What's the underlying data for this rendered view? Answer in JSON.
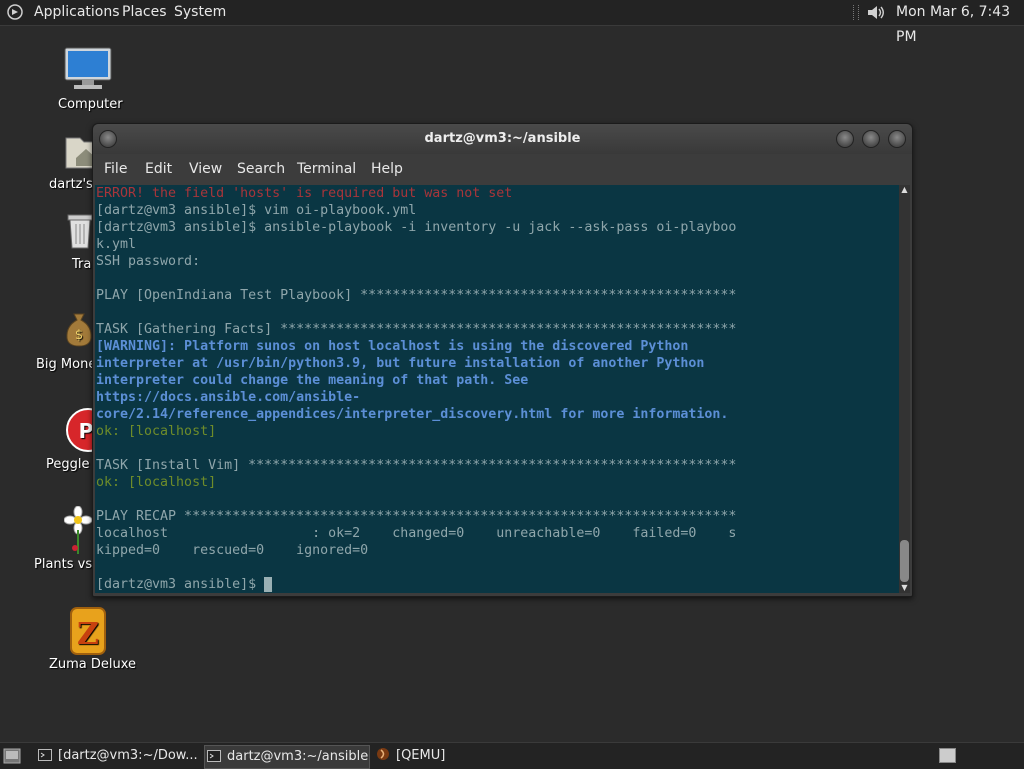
{
  "top_panel": {
    "menus": [
      "Applications",
      "Places",
      "System"
    ],
    "clock": "Mon Mar  6,  7:43 PM",
    "icons": {
      "apps": "gnome-foot-icon",
      "volume": "speaker-icon"
    }
  },
  "desktop_icons": [
    {
      "label": "Computer",
      "icon": "computer-icon"
    },
    {
      "label": "dartz's",
      "icon": "home-folder-icon"
    },
    {
      "label": "Tra",
      "icon": "trash-icon"
    },
    {
      "label": "Big Mone",
      "icon": "money-bag-icon"
    },
    {
      "label": "Peggle",
      "icon": "peggle-icon"
    },
    {
      "label": "Plants vs Z",
      "icon": "flower-icon"
    },
    {
      "label": "Zuma Deluxe",
      "icon": "zuma-icon"
    }
  ],
  "window": {
    "title": "dartz@vm3:~/ansible",
    "menu": [
      "File",
      "Edit",
      "View",
      "Search",
      "Terminal",
      "Help"
    ],
    "colors": {
      "background": "#0a3643",
      "text": "#8fa6ab",
      "error": "#a8353a",
      "warning": "#5c8fd6",
      "ok": "#6e8c2a"
    }
  },
  "terminal": {
    "lines": [
      "ERROR! the field 'hosts' is required but was not set",
      "[dartz@vm3 ansible]$ vim oi-playbook.yml",
      "[dartz@vm3 ansible]$ ansible-playbook -i inventory -u jack --ask-pass oi-playboo",
      "k.yml",
      "SSH password:",
      "",
      "PLAY [OpenIndiana Test Playbook] ***********************************************",
      "",
      "TASK [Gathering Facts] *********************************************************",
      "[WARNING]: Platform sunos on host localhost is using the discovered Python",
      "interpreter at /usr/bin/python3.9, but future installation of another Python",
      "interpreter could change the meaning of that path. See",
      "https://docs.ansible.com/ansible-",
      "core/2.14/reference_appendices/interpreter_discovery.html for more information.",
      "ok: [localhost]",
      "",
      "TASK [Install Vim] *************************************************************",
      "ok: [localhost]",
      "",
      "PLAY RECAP *********************************************************************",
      "localhost                  : ok=2    changed=0    unreachable=0    failed=0    s",
      "kipped=0    rescued=0    ignored=0",
      "",
      "[dartz@vm3 ansible]$ "
    ]
  },
  "taskbar": {
    "tasks": [
      {
        "label": "[dartz@vm3:~/Dow...",
        "icon": "terminal-icon",
        "active": false
      },
      {
        "label": "dartz@vm3:~/ansible",
        "icon": "terminal-icon",
        "active": true
      },
      {
        "label": "[QEMU]",
        "icon": "qemu-icon",
        "active": false
      }
    ]
  }
}
